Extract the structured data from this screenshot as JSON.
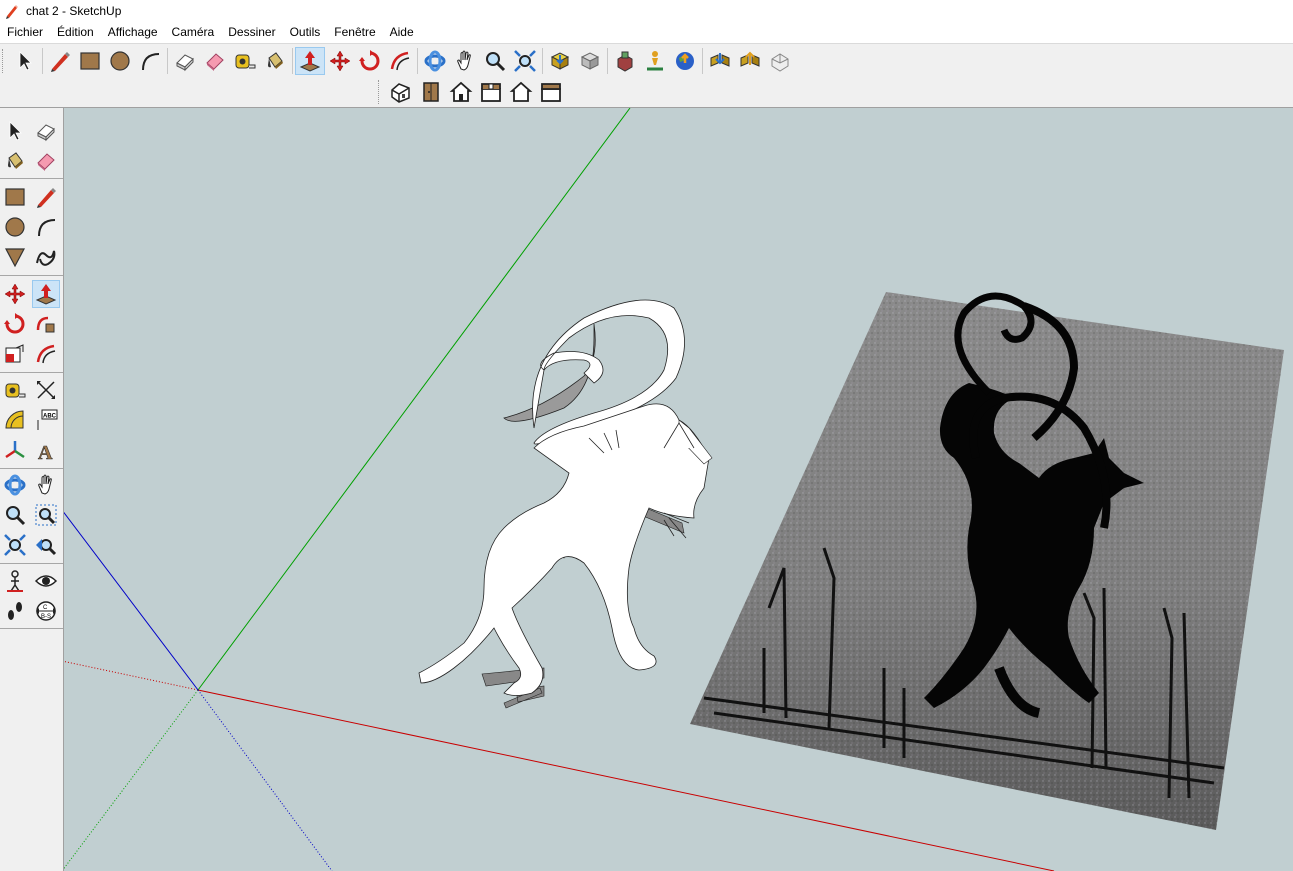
{
  "window": {
    "title": "chat 2 - SketchUp",
    "app_icon": "sketchup-pencil-icon"
  },
  "menu": [
    "Fichier",
    "Édition",
    "Affichage",
    "Caméra",
    "Dessiner",
    "Outils",
    "Fenêtre",
    "Aide"
  ],
  "toolbar_main": [
    {
      "name": "select-icon"
    },
    {
      "name": "pencil-line-icon"
    },
    {
      "name": "rectangle-icon"
    },
    {
      "name": "circle-icon"
    },
    {
      "name": "arc-icon"
    },
    {
      "name": "make-component-icon"
    },
    {
      "name": "eraser-icon"
    },
    {
      "name": "tape-measure-icon"
    },
    {
      "name": "paint-bucket-icon"
    },
    {
      "name": "push-pull-icon",
      "active": true
    },
    {
      "name": "move-icon"
    },
    {
      "name": "rotate-icon"
    },
    {
      "name": "offset-icon"
    },
    {
      "name": "orbit-icon"
    },
    {
      "name": "pan-icon"
    },
    {
      "name": "zoom-icon"
    },
    {
      "name": "zoom-extents-icon"
    },
    {
      "name": "get-models-icon"
    },
    {
      "name": "share-model-icon"
    },
    {
      "name": "extension-warehouse-icon"
    },
    {
      "name": "add-location-icon"
    },
    {
      "name": "google-earth-icon"
    },
    {
      "name": "component-get-icon"
    },
    {
      "name": "component-share-icon"
    },
    {
      "name": "extension-manager-icon"
    }
  ],
  "toolbar_views": [
    "iso-view-icon",
    "top-view-icon",
    "front-view-icon",
    "right-view-icon",
    "back-view-icon",
    "left-view-icon"
  ],
  "left_tools": [
    "select-icon",
    "make-component-icon",
    "paint-bucket-icon",
    "eraser-icon",
    "rectangle-icon",
    "pencil-line-icon",
    "circle-icon",
    "arc-icon",
    "polygon-icon",
    "freehand-icon",
    "move-icon",
    "push-pull-icon",
    "rotate-icon",
    "follow-me-icon",
    "scale-icon",
    "offset-icon",
    "tape-measure-icon",
    "dimension-icon",
    "protractor-icon",
    "text-icon",
    "axes-icon",
    "3d-text-icon",
    "orbit-icon",
    "pan-icon",
    "zoom-icon",
    "zoom-window-icon",
    "zoom-extents-icon",
    "previous-view-icon",
    "position-camera-icon",
    "look-around-icon",
    "walk-icon",
    "section-plane-icon"
  ],
  "colors": {
    "viewport_bg": "#c1cfd1",
    "axis_red": "#c80000",
    "axis_green": "#00a000",
    "axis_blue": "#0000c8"
  },
  "scene": {
    "model": "white-cat-silhouette-extrusion",
    "image": "black-cat-reference-photo"
  }
}
